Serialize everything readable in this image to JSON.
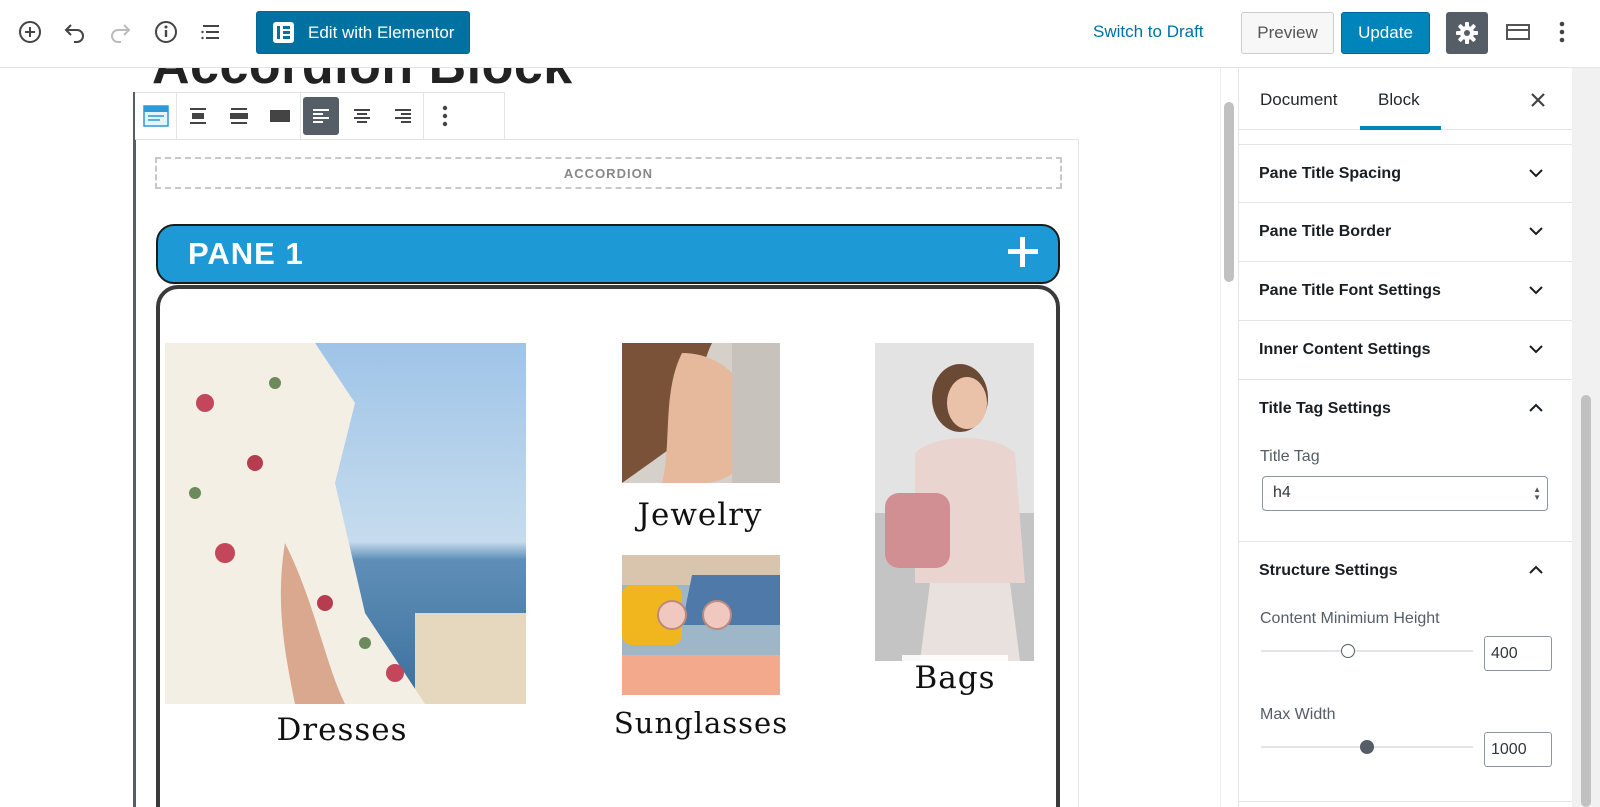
{
  "topbar": {
    "add_block_icon": "plus-circle-icon",
    "undo_icon": "undo-icon",
    "redo_icon": "redo-icon",
    "info_icon": "info-icon",
    "outline_icon": "list-outline-icon",
    "elementor_label": "Edit with Elementor",
    "switch_draft": "Switch to Draft",
    "preview": "Preview",
    "update": "Update",
    "settings_icon": "gear-icon",
    "fullwidth_icon": "layout-icon",
    "more_icon": "vertical-ellipsis-icon"
  },
  "editor": {
    "post_title": "Accordion Block",
    "accordion_label": "ACCORDION",
    "pane_title": "PANE 1",
    "images": [
      {
        "label": "Dresses"
      },
      {
        "label": "Jewelry"
      },
      {
        "label": "Sunglasses"
      },
      {
        "label": "Bags"
      }
    ]
  },
  "sidebar": {
    "tabs": [
      "Document",
      "Block"
    ],
    "active_tab": "Block",
    "panels": [
      {
        "title": "Pane Title Spacing",
        "open": false
      },
      {
        "title": "Pane Title Border",
        "open": false
      },
      {
        "title": "Pane Title Font Settings",
        "open": false
      },
      {
        "title": "Inner Content Settings",
        "open": false
      },
      {
        "title": "Title Tag Settings",
        "open": true
      },
      {
        "title": "Structure Settings",
        "open": true
      }
    ],
    "title_tag": {
      "label": "Title Tag",
      "value": "h4"
    },
    "content_min_height": {
      "label": "Content Minimium Height",
      "value": "400",
      "slider_fraction": 0.41
    },
    "max_width": {
      "label": "Max Width",
      "value": "1000",
      "slider_fraction": 0.5
    }
  },
  "colors": {
    "accent": "#0085ba",
    "pane_blue": "#1d9ad6",
    "dark": "#555d66"
  }
}
